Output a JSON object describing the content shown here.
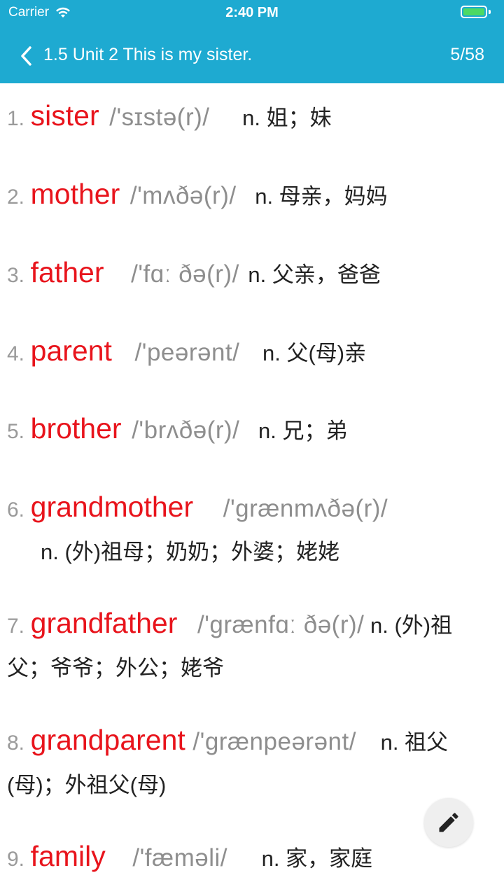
{
  "status": {
    "carrier": "Carrier",
    "time": "2:40 PM",
    "battery_level": 1.0
  },
  "nav": {
    "title": "1.5 Unit 2 This is my sister.",
    "count": "5/58"
  },
  "entries": [
    {
      "num": "1.",
      "word": "sister",
      "phonetic": "/'sɪstə(r)/",
      "meaning": "n. 姐；妹"
    },
    {
      "num": "2.",
      "word": "mother",
      "phonetic": "/'mʌðə(r)/",
      "meaning": "n. 母亲，妈妈"
    },
    {
      "num": "3.",
      "word": "father",
      "phonetic": "/'fɑː ðə(r)/",
      "meaning": "n. 父亲，爸爸"
    },
    {
      "num": "4.",
      "word": "parent",
      "phonetic": "/'peərənt/",
      "meaning": "n. 父(母)亲"
    },
    {
      "num": "5.",
      "word": "brother",
      "phonetic": "/'brʌðə(r)/",
      "meaning": "n. 兄；弟"
    },
    {
      "num": "6.",
      "word": "grandmother",
      "phonetic": "/'grænmʌðə(r)/",
      "meaning": "n. (外)祖母；奶奶；外婆；姥姥"
    },
    {
      "num": "7.",
      "word": "grandfather",
      "phonetic": "/'grænfɑː ðə(r)/",
      "meaning": "n. (外)祖父；爷爷；外公；姥爷"
    },
    {
      "num": "8.",
      "word": "grandparent",
      "phonetic": "/'grænpeərənt/",
      "meaning": "n. 祖父(母)；外祖父(母)"
    },
    {
      "num": "9.",
      "word": "family",
      "phonetic": "/'fæməli/",
      "meaning": "n. 家，家庭"
    }
  ],
  "icons": {
    "back": "chevron-left-icon",
    "edit": "pencil-icon",
    "wifi": "wifi-icon",
    "battery": "battery-icon"
  },
  "colors": {
    "header": "#1eaad1",
    "word": "#e8141c",
    "phonetic": "#8e8e8e",
    "battery": "#4cd964"
  }
}
